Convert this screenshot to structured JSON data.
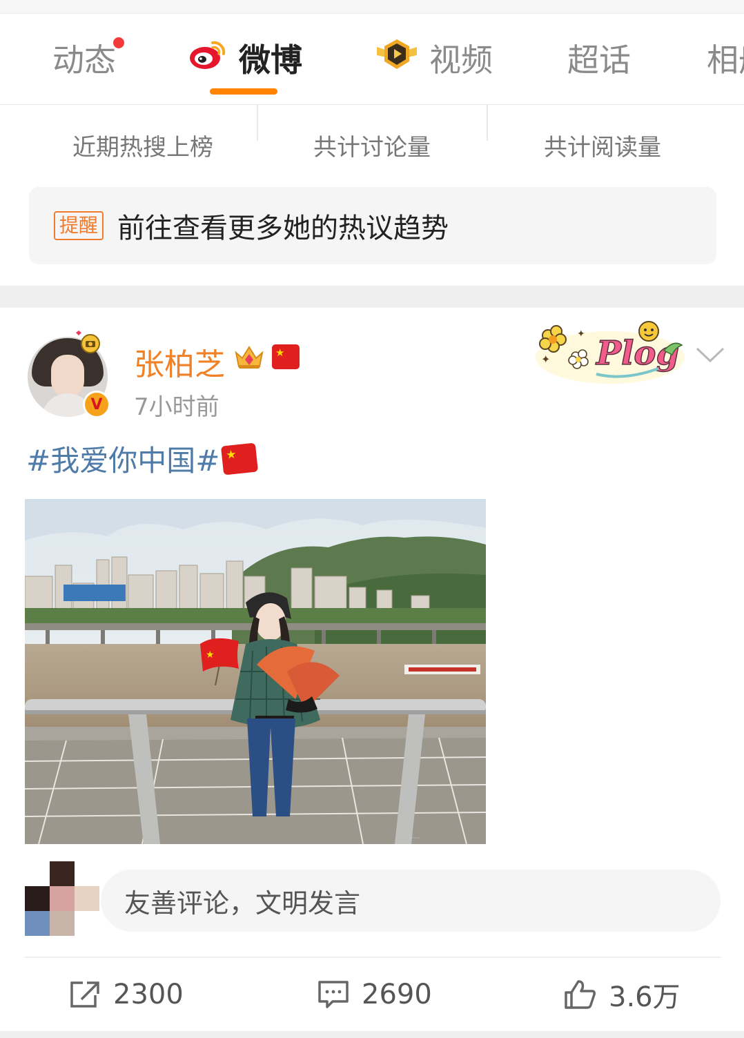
{
  "tabs": [
    {
      "label": "动态",
      "active": false,
      "has_dot": true
    },
    {
      "label": "微博",
      "active": true,
      "icon": "weibo-logo-icon"
    },
    {
      "label": "视频",
      "active": false,
      "icon": "video-play-icon"
    },
    {
      "label": "超话",
      "active": false
    },
    {
      "label": "相册",
      "active": false
    }
  ],
  "stats": [
    {
      "label": "近期热搜上榜"
    },
    {
      "label": "共计讨论量"
    },
    {
      "label": "共计阅读量"
    }
  ],
  "reminder": {
    "badge": "提醒",
    "text": "前往查看更多她的热议趋势"
  },
  "post": {
    "author": "张柏芝",
    "time": "7小时前",
    "hashtag": "#我爱你中国#",
    "photo_description": "",
    "badges": [
      "crown-icon",
      "china-flag-icon",
      "verified-v-icon"
    ],
    "sticker_text": "Plog"
  },
  "comment": {
    "placeholder": "友善评论，文明发言"
  },
  "actions": {
    "repost_count": "2300",
    "comment_count": "2690",
    "like_count": "3.6万"
  },
  "colors": {
    "accent": "#ff8200",
    "username": "#f08126",
    "hashtag": "#4e7ba8",
    "badge": "#f07b2d"
  }
}
